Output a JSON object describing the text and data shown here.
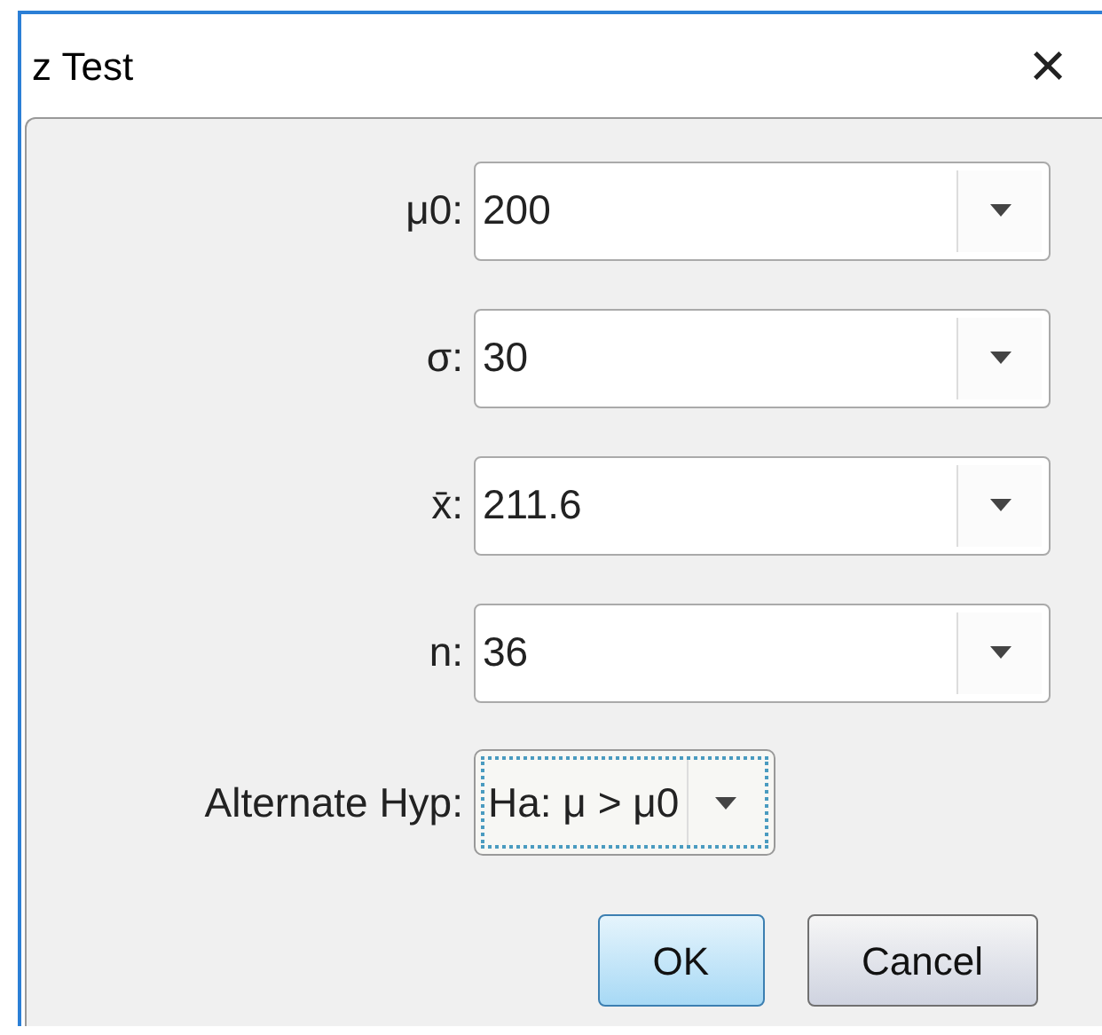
{
  "window": {
    "title": "z Test",
    "close": "×"
  },
  "fields": [
    {
      "label": "μ0:",
      "value": "200"
    },
    {
      "label": "σ:",
      "value": "30"
    },
    {
      "label": "x̄:",
      "value": "211.6"
    },
    {
      "label": "n:",
      "value": "36"
    }
  ],
  "alternate": {
    "label": "Alternate Hyp:",
    "value": "Ha: μ > μ0",
    "focused": true
  },
  "buttons": [
    {
      "label": "OK",
      "default": true
    },
    {
      "label": "Cancel",
      "default": false
    }
  ]
}
